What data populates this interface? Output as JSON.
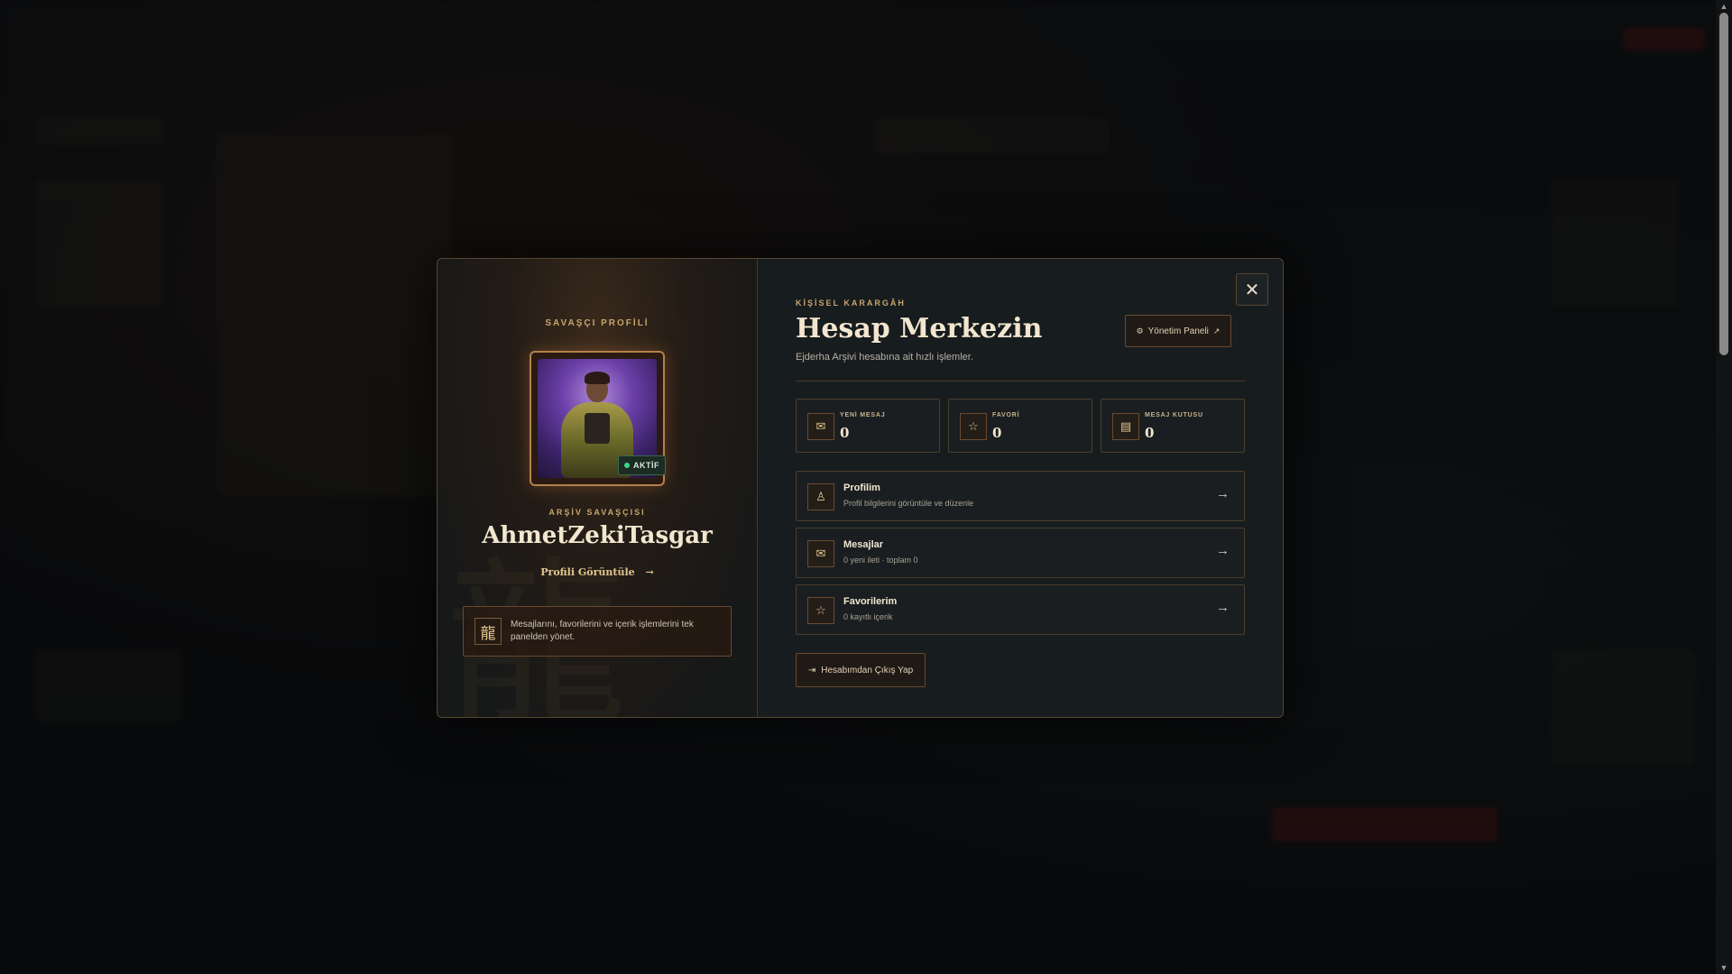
{
  "left": {
    "eyebrow": "SAVAŞÇI PROFİLİ",
    "status": "AKTİF",
    "rank": "ARŞİV SAVAŞÇISI",
    "username": "AhmetZekiTasgar",
    "profile_link": "Profili Görüntüle",
    "profile_link_arrow": "→",
    "info_icon_glyph": "龍",
    "info_text": "Mesajlarını, favorilerini ve içerik işlemlerini tek panelden yönet.",
    "watermark": "龍"
  },
  "right": {
    "eyebrow": "KİŞİSEL KARARGÂH",
    "title": "Hesap Merkezin",
    "subtitle": "Ejderha Arşivi hesabına ait hızlı işlemler.",
    "admin_button": "Yönetim Paneli",
    "close_glyph": "✕",
    "stats": [
      {
        "label": "YENİ MESAJ",
        "value": "0",
        "icon": "mail-icon",
        "glyph": "✉"
      },
      {
        "label": "FAVORİ",
        "value": "0",
        "icon": "star-icon",
        "glyph": "☆"
      },
      {
        "label": "MESAJ KUTUSU",
        "value": "0",
        "icon": "inbox-icon",
        "glyph": "▤"
      }
    ],
    "nav": [
      {
        "title": "Profilim",
        "sub": "Profil bilgilerini görüntüle ve düzenle",
        "icon": "user-icon",
        "glyph": "♙",
        "arrow": "→"
      },
      {
        "title": "Mesajlar",
        "sub": "0 yeni ileti · toplam 0",
        "icon": "mail-icon",
        "glyph": "✉",
        "arrow": "→"
      },
      {
        "title": "Favorilerim",
        "sub": "0 kayıtlı içerik",
        "icon": "star-icon",
        "glyph": "☆",
        "arrow": "→"
      }
    ],
    "logout_button": "Hesabımdan Çıkış Yap",
    "logout_glyph": "⇥"
  },
  "colors": {
    "accent": "#c9a46c",
    "status_green": "#3ed68a",
    "border": "#6a4a30"
  }
}
